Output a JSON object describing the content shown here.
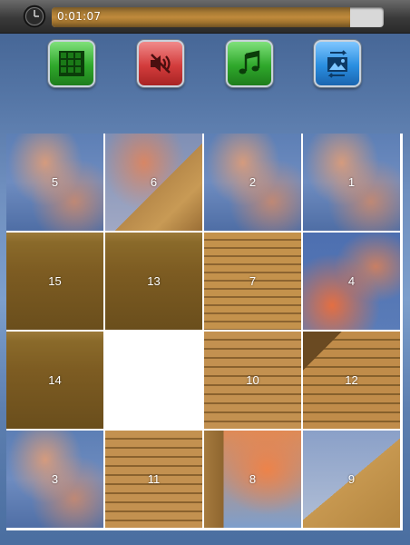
{
  "timer": {
    "elapsed": "0:01:07",
    "progress": 0.9
  },
  "toolbar": {
    "buttons": [
      {
        "id": "grid",
        "icon": "grid-icon",
        "color": "#2fa82b"
      },
      {
        "id": "mute",
        "icon": "speaker-muted-icon",
        "color": "#d33c3c"
      },
      {
        "id": "music",
        "icon": "music-note-icon",
        "color": "#2fa82b"
      },
      {
        "id": "image",
        "icon": "swap-image-icon",
        "color": "#2a8ee0"
      }
    ]
  },
  "puzzle": {
    "grid": 4,
    "empty_position": [
      2,
      1
    ],
    "tiles": [
      [
        "5",
        "6",
        "2",
        "1"
      ],
      [
        "15",
        "13",
        "7",
        "4"
      ],
      [
        "14",
        "",
        "10",
        "12"
      ],
      [
        "3",
        "11",
        "8",
        "9"
      ]
    ],
    "tile_kinds": {
      "1": "sky",
      "2": "sky",
      "3": "sky",
      "4": "sunset",
      "5": "sky",
      "6": "pyramid-edge",
      "7": "temple-top",
      "8": "sunset-edge",
      "9": "pyramid-corner",
      "10": "stairs",
      "11": "stairs",
      "12": "stairs-right",
      "13": "grass",
      "14": "grass",
      "15": "grass"
    }
  }
}
